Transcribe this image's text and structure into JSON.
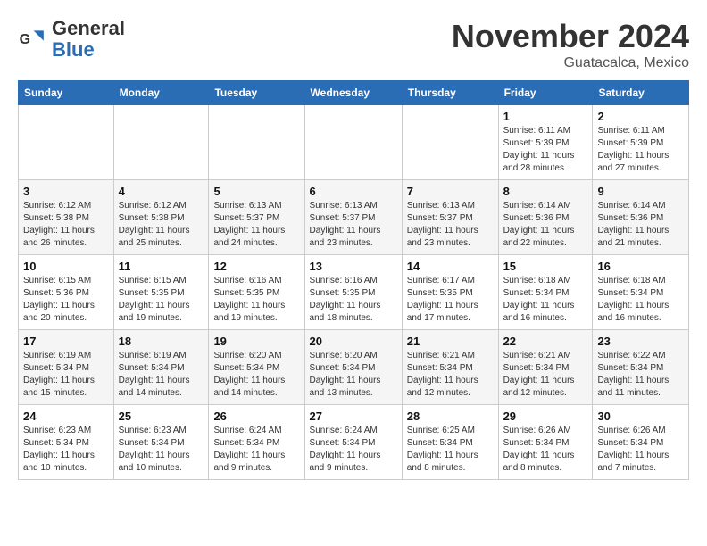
{
  "logo": {
    "text_general": "General",
    "text_blue": "Blue"
  },
  "title": "November 2024",
  "location": "Guatacalca, Mexico",
  "days_of_week": [
    "Sunday",
    "Monday",
    "Tuesday",
    "Wednesday",
    "Thursday",
    "Friday",
    "Saturday"
  ],
  "weeks": [
    [
      {
        "day": "",
        "info": ""
      },
      {
        "day": "",
        "info": ""
      },
      {
        "day": "",
        "info": ""
      },
      {
        "day": "",
        "info": ""
      },
      {
        "day": "",
        "info": ""
      },
      {
        "day": "1",
        "info": "Sunrise: 6:11 AM\nSunset: 5:39 PM\nDaylight: 11 hours and 28 minutes."
      },
      {
        "day": "2",
        "info": "Sunrise: 6:11 AM\nSunset: 5:39 PM\nDaylight: 11 hours and 27 minutes."
      }
    ],
    [
      {
        "day": "3",
        "info": "Sunrise: 6:12 AM\nSunset: 5:38 PM\nDaylight: 11 hours and 26 minutes."
      },
      {
        "day": "4",
        "info": "Sunrise: 6:12 AM\nSunset: 5:38 PM\nDaylight: 11 hours and 25 minutes."
      },
      {
        "day": "5",
        "info": "Sunrise: 6:13 AM\nSunset: 5:37 PM\nDaylight: 11 hours and 24 minutes."
      },
      {
        "day": "6",
        "info": "Sunrise: 6:13 AM\nSunset: 5:37 PM\nDaylight: 11 hours and 23 minutes."
      },
      {
        "day": "7",
        "info": "Sunrise: 6:13 AM\nSunset: 5:37 PM\nDaylight: 11 hours and 23 minutes."
      },
      {
        "day": "8",
        "info": "Sunrise: 6:14 AM\nSunset: 5:36 PM\nDaylight: 11 hours and 22 minutes."
      },
      {
        "day": "9",
        "info": "Sunrise: 6:14 AM\nSunset: 5:36 PM\nDaylight: 11 hours and 21 minutes."
      }
    ],
    [
      {
        "day": "10",
        "info": "Sunrise: 6:15 AM\nSunset: 5:36 PM\nDaylight: 11 hours and 20 minutes."
      },
      {
        "day": "11",
        "info": "Sunrise: 6:15 AM\nSunset: 5:35 PM\nDaylight: 11 hours and 19 minutes."
      },
      {
        "day": "12",
        "info": "Sunrise: 6:16 AM\nSunset: 5:35 PM\nDaylight: 11 hours and 19 minutes."
      },
      {
        "day": "13",
        "info": "Sunrise: 6:16 AM\nSunset: 5:35 PM\nDaylight: 11 hours and 18 minutes."
      },
      {
        "day": "14",
        "info": "Sunrise: 6:17 AM\nSunset: 5:35 PM\nDaylight: 11 hours and 17 minutes."
      },
      {
        "day": "15",
        "info": "Sunrise: 6:18 AM\nSunset: 5:34 PM\nDaylight: 11 hours and 16 minutes."
      },
      {
        "day": "16",
        "info": "Sunrise: 6:18 AM\nSunset: 5:34 PM\nDaylight: 11 hours and 16 minutes."
      }
    ],
    [
      {
        "day": "17",
        "info": "Sunrise: 6:19 AM\nSunset: 5:34 PM\nDaylight: 11 hours and 15 minutes."
      },
      {
        "day": "18",
        "info": "Sunrise: 6:19 AM\nSunset: 5:34 PM\nDaylight: 11 hours and 14 minutes."
      },
      {
        "day": "19",
        "info": "Sunrise: 6:20 AM\nSunset: 5:34 PM\nDaylight: 11 hours and 14 minutes."
      },
      {
        "day": "20",
        "info": "Sunrise: 6:20 AM\nSunset: 5:34 PM\nDaylight: 11 hours and 13 minutes."
      },
      {
        "day": "21",
        "info": "Sunrise: 6:21 AM\nSunset: 5:34 PM\nDaylight: 11 hours and 12 minutes."
      },
      {
        "day": "22",
        "info": "Sunrise: 6:21 AM\nSunset: 5:34 PM\nDaylight: 11 hours and 12 minutes."
      },
      {
        "day": "23",
        "info": "Sunrise: 6:22 AM\nSunset: 5:34 PM\nDaylight: 11 hours and 11 minutes."
      }
    ],
    [
      {
        "day": "24",
        "info": "Sunrise: 6:23 AM\nSunset: 5:34 PM\nDaylight: 11 hours and 10 minutes."
      },
      {
        "day": "25",
        "info": "Sunrise: 6:23 AM\nSunset: 5:34 PM\nDaylight: 11 hours and 10 minutes."
      },
      {
        "day": "26",
        "info": "Sunrise: 6:24 AM\nSunset: 5:34 PM\nDaylight: 11 hours and 9 minutes."
      },
      {
        "day": "27",
        "info": "Sunrise: 6:24 AM\nSunset: 5:34 PM\nDaylight: 11 hours and 9 minutes."
      },
      {
        "day": "28",
        "info": "Sunrise: 6:25 AM\nSunset: 5:34 PM\nDaylight: 11 hours and 8 minutes."
      },
      {
        "day": "29",
        "info": "Sunrise: 6:26 AM\nSunset: 5:34 PM\nDaylight: 11 hours and 8 minutes."
      },
      {
        "day": "30",
        "info": "Sunrise: 6:26 AM\nSunset: 5:34 PM\nDaylight: 11 hours and 7 minutes."
      }
    ]
  ]
}
